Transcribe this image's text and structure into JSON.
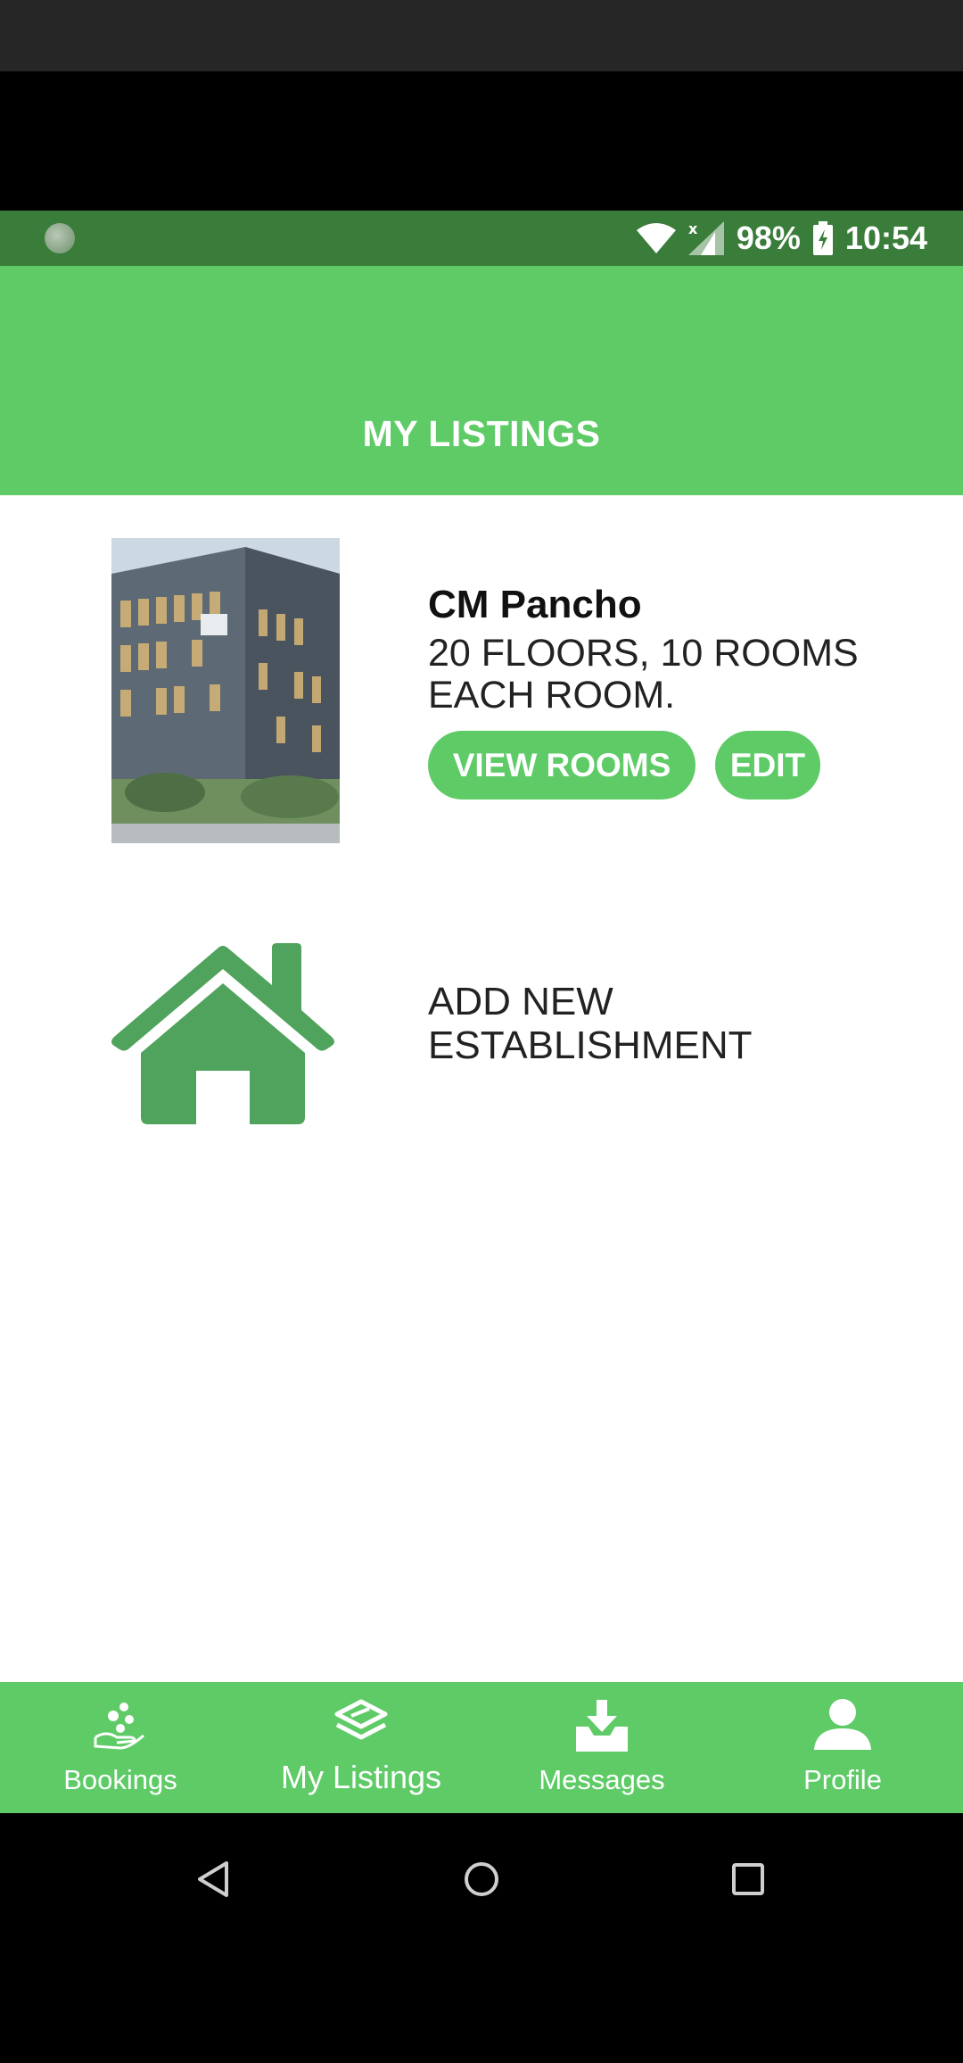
{
  "status_bar": {
    "battery": "98%",
    "time": "10:54"
  },
  "header": {
    "title": "MY LISTINGS"
  },
  "listing": {
    "name": "CM Pancho",
    "description": "20 FLOORS, 10 ROOMS EACH ROOM.",
    "view_rooms_label": "VIEW ROOMS",
    "edit_label": "EDIT"
  },
  "add_establishment": {
    "line1": "ADD NEW",
    "line2": "ESTABLISHMENT",
    "icon": "home-icon"
  },
  "bottom_nav": [
    {
      "label": "Bookings",
      "icon": "bookings-icon",
      "active": false
    },
    {
      "label": "My Listings",
      "icon": "listings-icon",
      "active": true
    },
    {
      "label": "Messages",
      "icon": "download-inbox-icon",
      "active": false
    },
    {
      "label": "Profile",
      "icon": "person-icon",
      "active": false
    }
  ],
  "colors": {
    "primary": "#5ecb67",
    "status_bar": "#3a7d3b",
    "house": "#4fa35c"
  }
}
